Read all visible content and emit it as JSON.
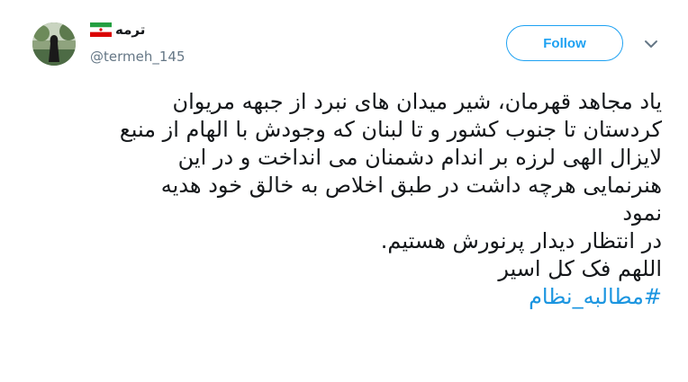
{
  "header": {
    "display_name": "ترمه",
    "handle": "@termeh_145",
    "follow_label": "Follow",
    "flag_icon": "iran-flag-icon",
    "avatar_icon": "profile-photo",
    "chevron_icon": "chevron-down-icon"
  },
  "tweet": {
    "lines": [
      "یاد مجاهد قهرمان، شیر میدان های نبرد از جبهه مریوان",
      "کردستان تا جنوب کشور و تا لبنان که وجودش با الهام از منبع",
      "لایزال الهی لرزه بر اندام دشمنان می انداخت و در این",
      "هنرنمایی هرچه داشت در طبق اخلاص به خالق خود هدیه",
      "نمود",
      " در انتظار دیدار پرنورش هستیم.",
      "اللهم فک کل اسیر"
    ],
    "hashtag": "#مطالبه_نظام"
  },
  "colors": {
    "accent": "#1da1f2",
    "hashtag": "#1b95e0",
    "text": "#14171a",
    "muted": "#657786"
  }
}
